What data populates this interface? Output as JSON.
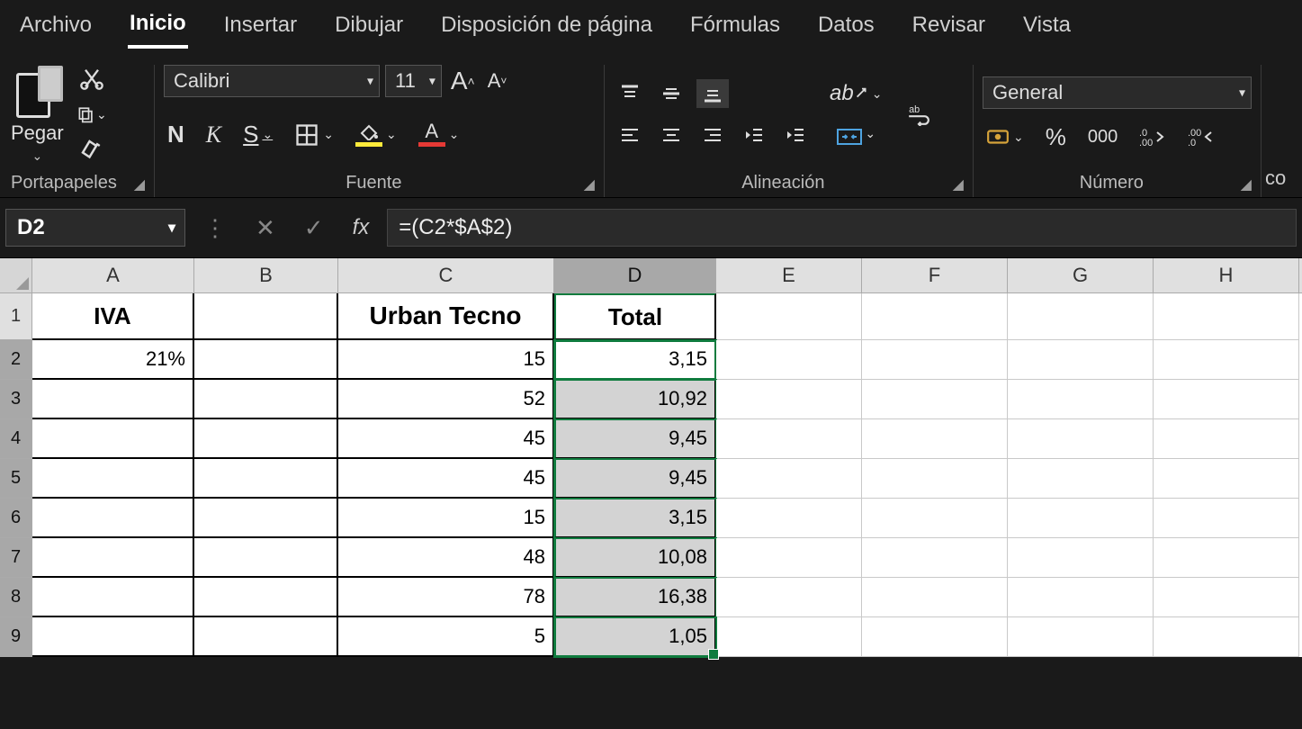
{
  "menu": {
    "items": [
      "Archivo",
      "Inicio",
      "Insertar",
      "Dibujar",
      "Disposición de página",
      "Fórmulas",
      "Datos",
      "Revisar",
      "Vista"
    ],
    "active": "Inicio"
  },
  "ribbon": {
    "clipboard": {
      "paste_label": "Pegar",
      "group_label": "Portapapeles"
    },
    "font": {
      "family": "Calibri",
      "size": "11",
      "group_label": "Fuente",
      "bold": "N",
      "italic": "K",
      "underline": "S"
    },
    "alignment": {
      "group_label": "Alineación"
    },
    "number": {
      "format": "General",
      "group_label": "Número",
      "percent": "%",
      "thousands": "000"
    },
    "edge": "co"
  },
  "formula_bar": {
    "name_box": "D2",
    "fx": "fx",
    "value": "=(C2*$A$2)"
  },
  "sheet": {
    "columns": [
      "A",
      "B",
      "C",
      "D",
      "E",
      "F",
      "G",
      "H"
    ],
    "selected_column": "D",
    "rows": [
      "1",
      "2",
      "3",
      "4",
      "5",
      "6",
      "7",
      "8",
      "9"
    ],
    "selected_rows": [
      "2",
      "3",
      "4",
      "5",
      "6",
      "7",
      "8",
      "9"
    ],
    "headers": {
      "A": "IVA",
      "C": "Urban Tecno",
      "D": "Total"
    },
    "data": {
      "A2": "21%",
      "C": [
        "15",
        "52",
        "45",
        "45",
        "15",
        "48",
        "78",
        "5"
      ],
      "D": [
        "3,15",
        "10,92",
        "9,45",
        "9,45",
        "3,15",
        "10,08",
        "16,38",
        "1,05"
      ]
    }
  }
}
